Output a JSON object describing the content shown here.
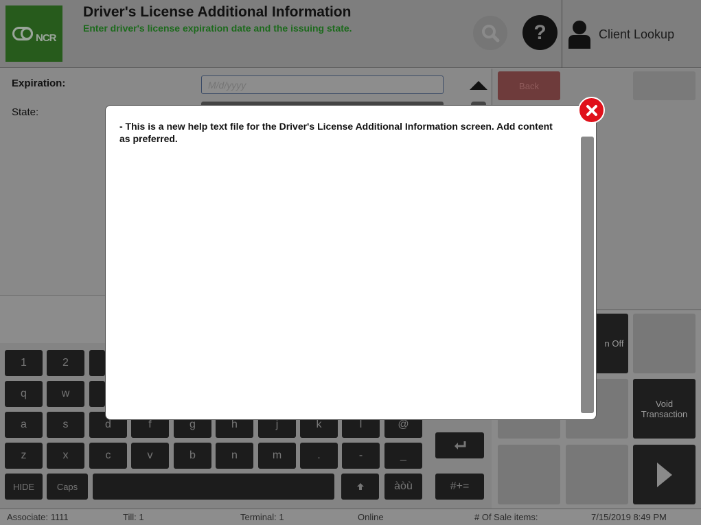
{
  "header": {
    "logo_text": "NCR",
    "title": "Driver's License Additional Information",
    "subtitle": "Enter driver's license expiration date and the issuing state.",
    "help_label": "?",
    "client_lookup_label": "Client Lookup"
  },
  "form": {
    "expiration_label": "Expiration:",
    "expiration_placeholder": "M/d/yyyy",
    "state_label": "State:"
  },
  "right_panel": {
    "back_label": "Back"
  },
  "keyboard": {
    "row1": [
      "1",
      "2"
    ],
    "row2": [
      "q",
      "w"
    ],
    "row3": [
      "a",
      "s",
      "d",
      "f",
      "g",
      "h",
      "j",
      "k",
      "l",
      "@"
    ],
    "row4": [
      "z",
      "x",
      "c",
      "v",
      "b",
      "n",
      "m",
      ".",
      "-",
      "_"
    ],
    "hide": "HIDE",
    "caps": "Caps",
    "accents": "àòù",
    "symbols": "#+="
  },
  "functions": {
    "off_label": "n Off",
    "void_label": "Void Transaction"
  },
  "status": {
    "associate": "Associate: 1111",
    "till": "Till: 1",
    "terminal": "Terminal: 1",
    "connection": "Online",
    "sale_items": "# Of Sale items:",
    "datetime": "7/15/2019 8:49 PM"
  },
  "modal": {
    "help_text": "- This is a new help text file for the Driver's License Additional Information screen. Add content as preferred."
  },
  "colors": {
    "close_red": "#e0101a",
    "subtitle_green": "#1c6a1c"
  }
}
